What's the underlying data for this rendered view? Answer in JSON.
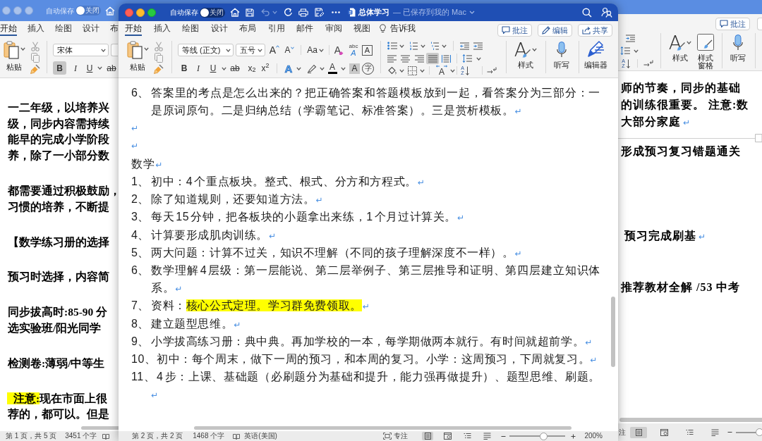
{
  "left_window": {
    "active": false,
    "autosave": {
      "label": "自动保存",
      "state": "关闭",
      "on": false
    },
    "tabs": [
      {
        "label": "开始",
        "selected": true
      },
      {
        "label": "插入",
        "selected": false
      },
      {
        "label": "绘图",
        "selected": false
      },
      {
        "label": "设计",
        "selected": false
      },
      {
        "label": "布",
        "selected": false
      }
    ],
    "paste_label": "粘贴",
    "clipboard_disabled": true,
    "font": "宋体",
    "format_buttons": [
      {
        "kind": "bold",
        "text": "B",
        "on": true
      },
      {
        "kind": "italic",
        "text": "I",
        "on": false
      },
      {
        "kind": "underline",
        "text": "U",
        "on": false
      },
      {
        "kind": "strike",
        "text": "ab",
        "on": false
      }
    ],
    "blocks": [
      {
        "lines": [
          {
            "text": "一二年级，以培养兴"
          },
          {
            "text": "级，同步内容需持续"
          },
          {
            "text": "能早的完成小学阶段"
          },
          {
            "text": "养，除了一小部分数"
          }
        ]
      },
      {
        "lines": [
          {
            "text": "都需要通过积极鼓励，"
          },
          {
            "text": "习惯的培养，不断提"
          }
        ]
      },
      {
        "lines": [
          {
            "text": "【数学练习册的选择"
          }
        ]
      },
      {
        "lines": [
          {
            "text": "预习时选择，内容简"
          }
        ]
      },
      {
        "lines": [
          {
            "text": "同步拔高时:85-90  分"
          },
          {
            "text": "选实验班/阳光同学"
          }
        ]
      },
      {
        "lines": [
          {
            "text": "检测卷:薄弱/中等生"
          }
        ]
      },
      {
        "lines": [
          {
            "highlight": "注意:",
            "text": "现在市面上很"
          },
          {
            "text": "荐的，都可以。但是"
          }
        ]
      }
    ],
    "status": {
      "page": "第 1 页，共 5 页",
      "words": "3451 个字"
    }
  },
  "main_window": {
    "active": true,
    "autosave": {
      "label": "自动保存",
      "state": "关闭",
      "on": false
    },
    "undo": {
      "disabled": true
    },
    "title": "总体学习",
    "save_status": "— 已保存到我的 Mac",
    "tabs": [
      {
        "label": "开始",
        "selected": true
      },
      {
        "label": "插入",
        "selected": false
      },
      {
        "label": "绘图",
        "selected": false
      },
      {
        "label": "设计",
        "selected": false
      },
      {
        "label": "布局",
        "selected": false
      },
      {
        "label": "引用",
        "selected": false
      },
      {
        "label": "邮件",
        "selected": false
      },
      {
        "label": "审阅",
        "selected": false
      },
      {
        "label": "视图",
        "selected": false
      }
    ],
    "tell_me": "告诉我",
    "actions": [
      {
        "kind": "comment",
        "label": "批注"
      },
      {
        "kind": "edit",
        "label": "编辑"
      },
      {
        "kind": "share",
        "label": "共享"
      }
    ],
    "paste_label": "粘贴",
    "clipboard_disabled": true,
    "font": "等线 (正文)",
    "size": "五号",
    "font_tools": [
      {
        "kind": "grow",
        "text": "A"
      },
      {
        "kind": "shrink",
        "text": "A"
      },
      {
        "kind": "case",
        "text": "Aa"
      },
      {
        "kind": "clear",
        "text": "A"
      },
      {
        "kind": "phonetic",
        "small": "abc",
        "text": "A"
      },
      {
        "kind": "border",
        "text": "A"
      }
    ],
    "format_buttons": [
      {
        "kind": "bold",
        "text": "B",
        "on": false
      },
      {
        "kind": "italic",
        "text": "I",
        "on": false
      },
      {
        "kind": "underline",
        "text": "U",
        "on": false
      },
      {
        "kind": "strike",
        "text": "ab",
        "on": false
      },
      {
        "kind": "subscript",
        "text": "x$_{2}$",
        "on": false
      },
      {
        "kind": "superscript",
        "text": "x$^{2}$",
        "on": false
      }
    ],
    "effect_tools": [
      {
        "kind": "text_effect",
        "text": "A"
      },
      {
        "kind": "highlight"
      },
      {
        "kind": "font_color",
        "text": "A"
      },
      {
        "kind": "shading",
        "text": "A"
      },
      {
        "kind": "enclose",
        "text": "字"
      }
    ],
    "alignment": [
      {
        "kind": "left",
        "selected": false
      },
      {
        "kind": "center",
        "selected": false
      },
      {
        "kind": "right",
        "selected": false
      },
      {
        "kind": "justify",
        "selected": true
      },
      {
        "kind": "distributed",
        "selected": false
      }
    ],
    "spacing_label": "A",
    "sort_label": "A Z",
    "big_buttons": [
      {
        "kind": "styles",
        "glyph": "A",
        "label": "样式"
      },
      {
        "kind": "dictate",
        "label": "听写"
      },
      {
        "kind": "editor",
        "label": "编辑器"
      }
    ],
    "document": {
      "paragraphs": [
        {
          "kind": "item",
          "number": "6、",
          "text": "答案里的考点是怎么出来的？把正确答案和答题模板放到一起，看答案分为三部分：一是原词原句。二是归纳总结（学霸笔记、标准答案）。三是赏析模板。",
          "mark": "↵"
        },
        {
          "kind": "empty",
          "mark": "↵"
        },
        {
          "kind": "empty",
          "mark": "↵"
        },
        {
          "kind": "heading",
          "text": "数学",
          "mark": "↵"
        },
        {
          "kind": "item",
          "number": "1、",
          "text": "初中：4 个重点板块。整式、根式、分方和方程式。",
          "mark": "↵"
        },
        {
          "kind": "item",
          "number": "2、",
          "text": "除了知道规则，还要知道方法。",
          "mark": "↵"
        },
        {
          "kind": "item",
          "number": "3、",
          "text": "每天 15 分钟，把各板块的小题拿出来练，1 个月过计算关。",
          "mark": "↵"
        },
        {
          "kind": "item",
          "number": "4、",
          "text": "计算要形成肌肉训练。",
          "mark": "↵"
        },
        {
          "kind": "item",
          "number": "5、",
          "text": "两大问题：计算不过关，知识不理解（不同的孩子理解深度不一样）。",
          "mark": "↵"
        },
        {
          "kind": "item",
          "number": "6、",
          "text": "数学理解 4 层级：第一层能说、第二层举例子、第三层推导和证明、第四层建立知识体系。",
          "mark": "↵"
        },
        {
          "kind": "item",
          "number": "7、",
          "text": "资料：",
          "highlight": "核心公式定理。学习群免费领取。",
          "mark": "↵"
        },
        {
          "kind": "item",
          "number": "8、",
          "text": "建立题型思维。",
          "mark": "↵"
        },
        {
          "kind": "item",
          "number": "9、",
          "text": "小学拔高练习册：典中典。再加学校的一本，每学期做两本就行。有时间就超前学。",
          "mark": "↵"
        },
        {
          "kind": "tabbed",
          "number": "10、",
          "text": "初中：每个周末，做下一周的预习，和本周的复习。小学：这周预习，下周就复习。",
          "mark": "↵"
        },
        {
          "kind": "tabbed",
          "number": "11、",
          "text": "4 步：上课、基础题（必刷题分为基础和提升，能力强再做提升）、题型思维、刷题。",
          "mark": "↵"
        }
      ]
    },
    "status": {
      "page": "第 2 页，共 2 页",
      "words": "1468 个字",
      "language": "英语(美国)",
      "focus": "专注",
      "views": [
        {
          "kind": "print",
          "selected": true
        },
        {
          "kind": "web",
          "selected": false
        },
        {
          "kind": "outline",
          "selected": false
        },
        {
          "kind": "draft",
          "selected": false
        }
      ],
      "zoom_slider": {
        "level": 0.61
      },
      "zoom": "200%"
    }
  },
  "right_window": {
    "active": false,
    "actions": [
      {
        "kind": "comment",
        "label": "批注"
      }
    ],
    "sort_label": "A Z",
    "big_buttons": [
      {
        "kind": "styles",
        "glyph": "A",
        "label": "样式"
      },
      {
        "kind": "styles_pane",
        "label": "样式窗格"
      },
      {
        "kind": "dictate",
        "label": "听写"
      }
    ],
    "blocks": [
      {
        "kind": "text",
        "lines": [
          {
            "text": "师的节奏，同步的基础"
          },
          {
            "text": "的训练很重要。 注意:数"
          },
          {
            "text": "大部分家庭",
            "mark": "↵"
          }
        ]
      },
      {
        "kind": "rule"
      },
      {
        "kind": "text",
        "lines": [
          {
            "text": "形成预习复习错题通关"
          }
        ]
      },
      {
        "kind": "text",
        "lines": [
          {
            "text": "预习完成刷基",
            "mark": "↵"
          }
        ]
      },
      {
        "kind": "text",
        "lines": [
          {
            "text": "推荐教材全解  /53  中考"
          }
        ]
      }
    ],
    "status": {
      "focus": "注",
      "views": [
        {
          "kind": "print",
          "selected": true
        },
        {
          "kind": "web",
          "selected": false
        },
        {
          "kind": "outline",
          "selected": false
        },
        {
          "kind": "draft",
          "selected": false
        }
      ],
      "zoom_slider": {
        "level": 0.9
      }
    }
  }
}
